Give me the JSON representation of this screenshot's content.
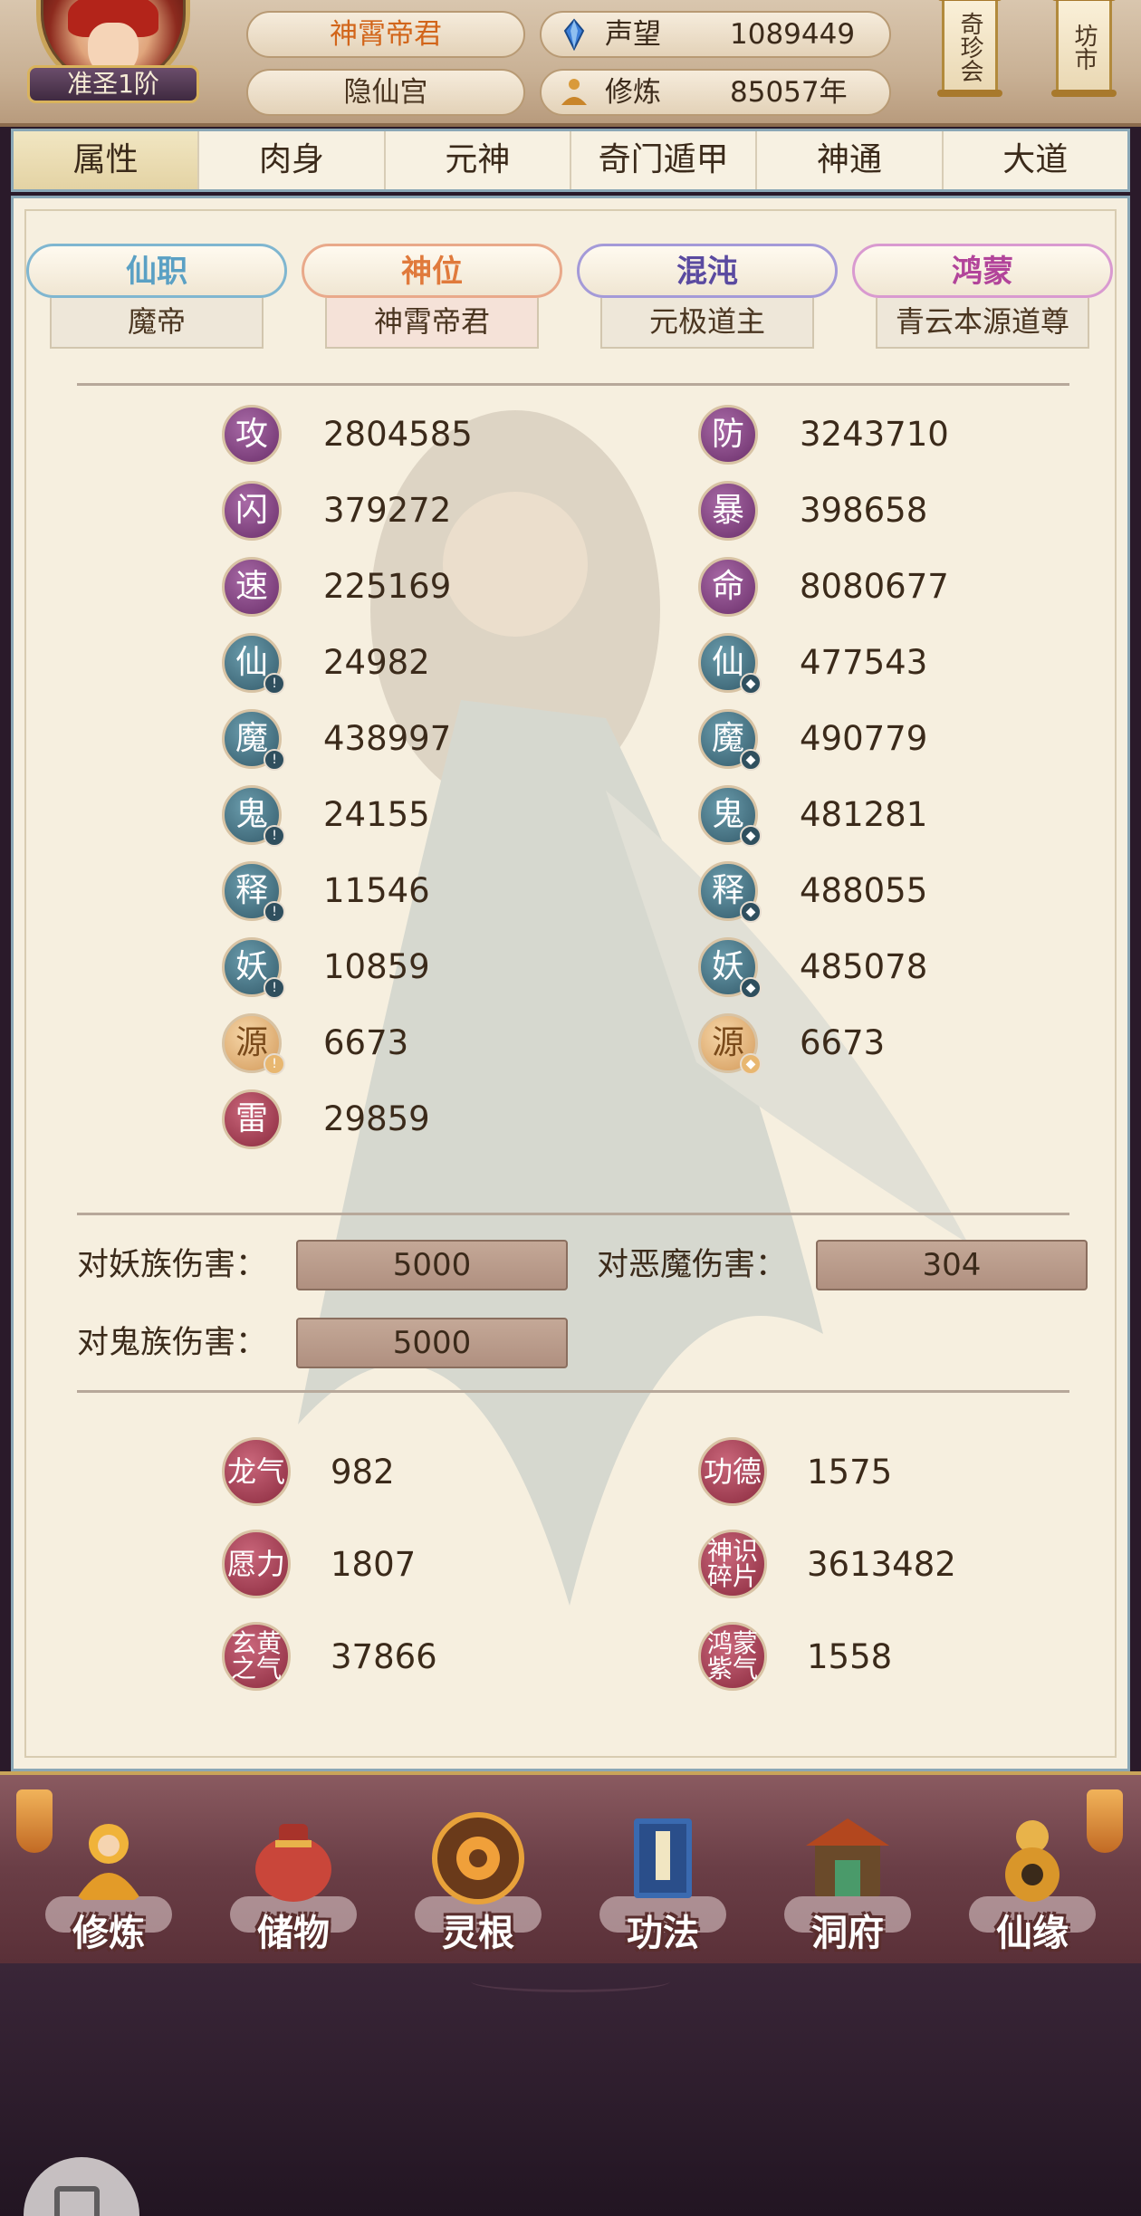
{
  "header": {
    "title": "神霄帝君",
    "sect": "隐仙宫",
    "rank_badge": "准圣1阶",
    "reputation_label": "声望",
    "reputation_value": "1089449",
    "cultivation_label": "修炼",
    "cultivation_value": "85057年",
    "scroll_buttons": [
      "奇珍会",
      "坊市"
    ]
  },
  "tabs": [
    {
      "label": "属性",
      "active": true
    },
    {
      "label": "肉身"
    },
    {
      "label": "元神"
    },
    {
      "label": "奇门遁甲"
    },
    {
      "label": "神通"
    },
    {
      "label": "大道"
    }
  ],
  "ranks": [
    {
      "label": "仙职",
      "value": "魔帝"
    },
    {
      "label": "神位",
      "value": "神霄帝君"
    },
    {
      "label": "混沌",
      "value": "元极道主"
    },
    {
      "label": "鸿蒙",
      "value": "青云本源道尊"
    }
  ],
  "attributes_left": [
    {
      "icon": "攻",
      "value": "2804585"
    },
    {
      "icon": "闪",
      "value": "379272"
    },
    {
      "icon": "速",
      "value": "225169"
    },
    {
      "icon": "仙",
      "value": "24982"
    },
    {
      "icon": "魔",
      "value": "438997"
    },
    {
      "icon": "鬼",
      "value": "24155"
    },
    {
      "icon": "释",
      "value": "11546"
    },
    {
      "icon": "妖",
      "value": "10859"
    },
    {
      "icon": "源",
      "value": "6673"
    },
    {
      "icon": "雷",
      "value": "29859"
    }
  ],
  "attributes_right": [
    {
      "icon": "防",
      "value": "3243710"
    },
    {
      "icon": "暴",
      "value": "398658"
    },
    {
      "icon": "命",
      "value": "8080677"
    },
    {
      "icon": "仙",
      "value": "477543"
    },
    {
      "icon": "魔",
      "value": "490779"
    },
    {
      "icon": "鬼",
      "value": "481281"
    },
    {
      "icon": "释",
      "value": "488055"
    },
    {
      "icon": "妖",
      "value": "485078"
    },
    {
      "icon": "源",
      "value": "6673"
    }
  ],
  "damage": [
    {
      "label": "对妖族伤害：",
      "value": "5000"
    },
    {
      "label": "对恶魔伤害：",
      "value": "304"
    },
    {
      "label": "对鬼族伤害：",
      "value": "5000"
    }
  ],
  "misc_left": [
    {
      "icon": "龙气",
      "value": "982"
    },
    {
      "icon": "愿力",
      "value": "1807"
    },
    {
      "icon": "玄黄之气",
      "value": "37866"
    }
  ],
  "misc_right": [
    {
      "icon": "功德",
      "value": "1575"
    },
    {
      "icon": "神识碎片",
      "value": "3613482"
    },
    {
      "icon": "鸿蒙紫气",
      "value": "1558"
    }
  ],
  "nav": [
    {
      "label": "修炼",
      "icon": "monk-icon"
    },
    {
      "label": "储物",
      "icon": "bag-icon"
    },
    {
      "label": "灵根",
      "icon": "spirit-root-icon"
    },
    {
      "label": "功法",
      "icon": "book-icon"
    },
    {
      "label": "洞府",
      "icon": "cave-icon"
    },
    {
      "label": "仙缘",
      "icon": "gourd-icon"
    }
  ]
}
